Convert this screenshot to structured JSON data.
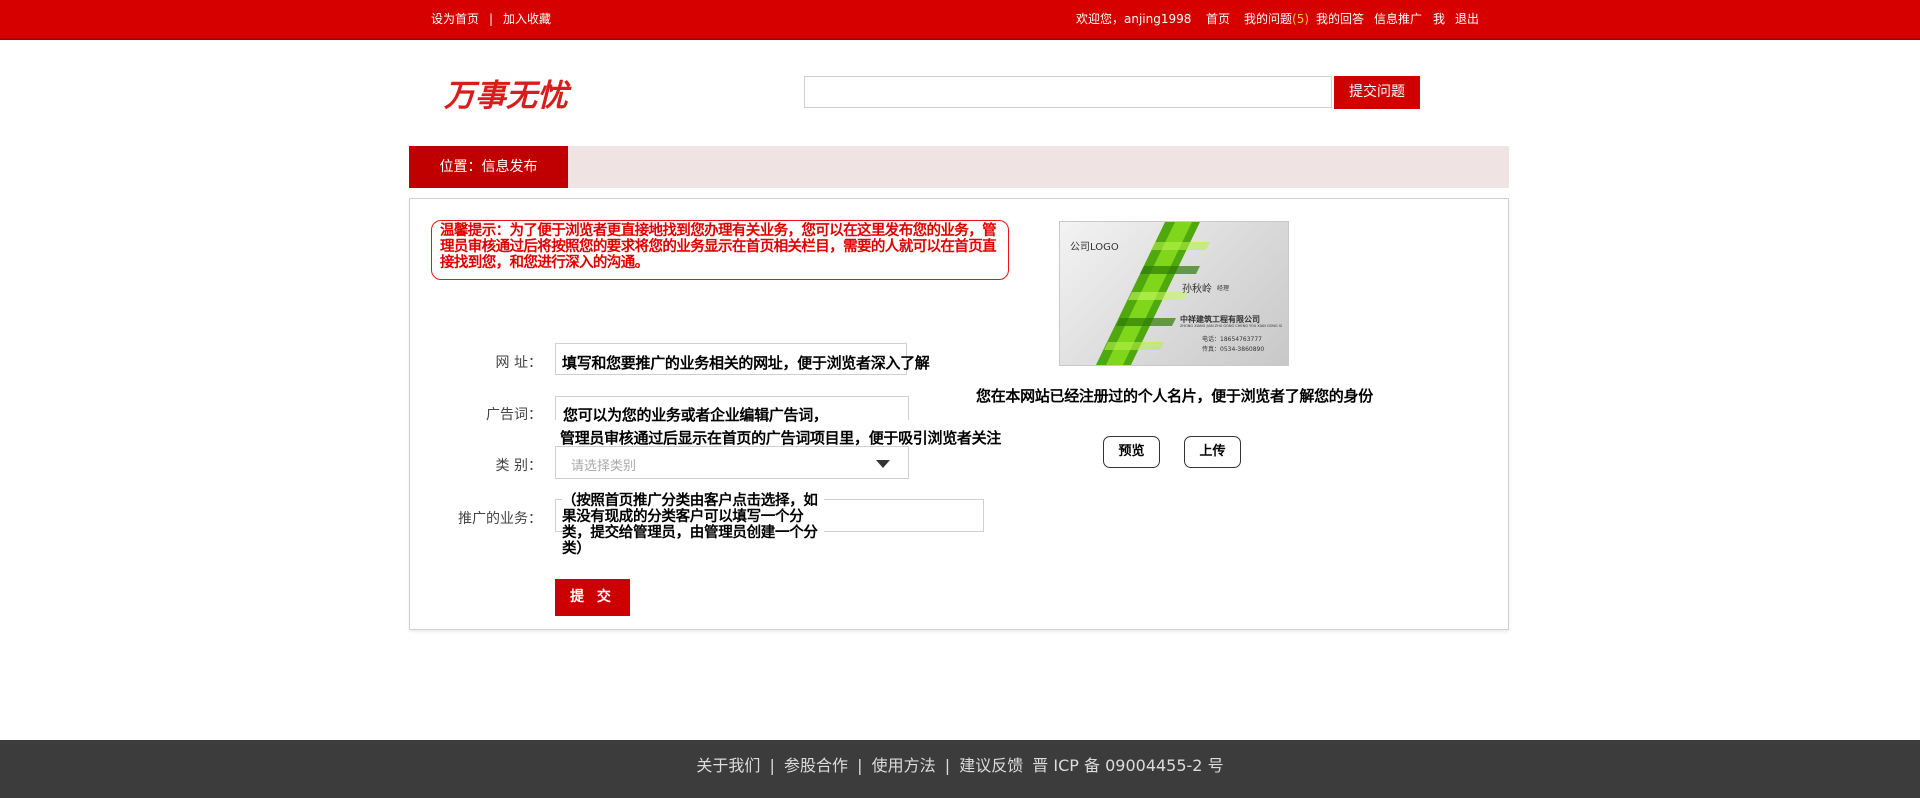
{
  "topbar": {
    "set_home": "设为首页",
    "separator": "|",
    "add_favorite": "加入收藏",
    "welcome": "欢迎您，anjing1998",
    "home": "首页",
    "my_questions": "我的问题",
    "my_questions_count": "(5)",
    "my_answers": "我的回答",
    "info_promo": "信息推广",
    "me": "我",
    "logout": "退出"
  },
  "header": {
    "logo_text": "万事无忧",
    "search_value": "",
    "ask_button": "提交问题"
  },
  "location": {
    "label": "位置：信息发布"
  },
  "tip": {
    "text": "温馨提示：为了便于浏览者更直接地找到您办理有关业务，您可以在这里发布您的业务，管理员审核通过后将按照您的要求将您的业务显示在首页相关栏目，需要的人就可以在首页直接找到您，和您进行深入的沟通。"
  },
  "card": {
    "logo": "公司LOGO",
    "name": "孙秋岭",
    "title": "经理",
    "company": "中祥建筑工程有限公司",
    "company_pinyin": "ZHONG XIANG JIAN ZHU GONG CHENG YOU XIAN GONG SI",
    "phone": "电话：18654763777",
    "fax": "传真：0534-3860890",
    "hint": "您在本网站已经注册过的个人名片，便于浏览者了解您的身份",
    "preview_button": "预览",
    "upload_button": "上传"
  },
  "form": {
    "url_label": "网  址：",
    "url_hint": "填写和您要推广的业务相关的网址，便于浏览者深入了解",
    "ad_label": "广告词：",
    "ad_hint_1": "您可以为您的业务或者企业编辑广告词，",
    "ad_hint_2": "管理员审核通过后显示在首页的广告词项目里，便于吸引浏览者关注",
    "category_label": "类  别：",
    "category_placeholder": "请选择类别",
    "business_label": "推广的业务：",
    "business_hint": "（按照首页推广分类由客户点击选择，如果没有现成的分类客户可以填写一个分类，提交给管理员，由管理员创建一个分类）",
    "submit_button": "提 交"
  },
  "footer": {
    "about": "关于我们",
    "cooperation": "参股合作",
    "usage": "使用方法",
    "feedback": "建议反馈",
    "icp": "晋 ICP 备 09004455-2 号",
    "separator": "|"
  },
  "colors": {
    "brand_red": "#d60000",
    "footer_bg": "#3c3c3c",
    "location_bg": "#efe3e4"
  }
}
